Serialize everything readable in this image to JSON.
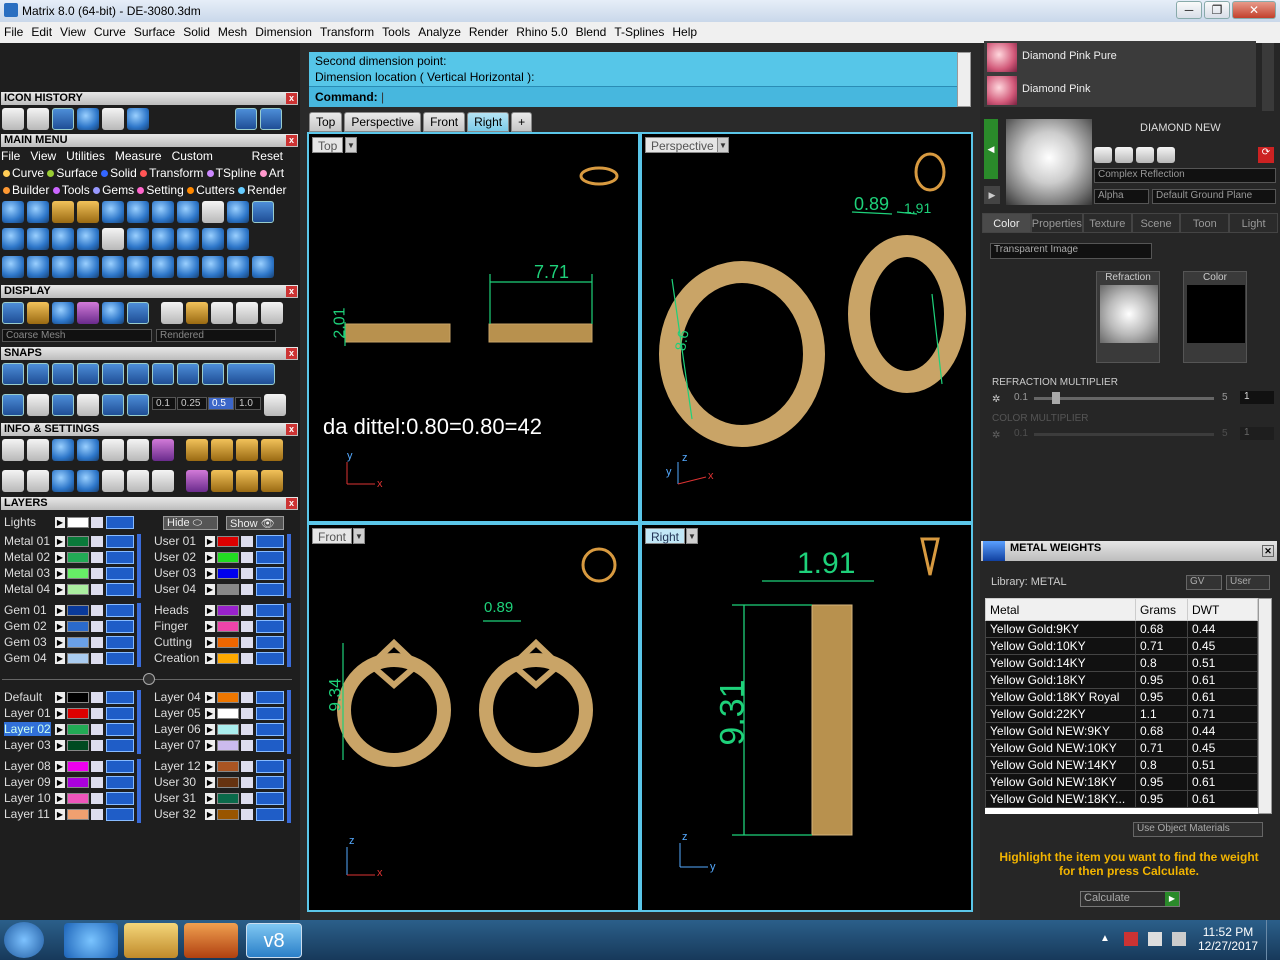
{
  "window": {
    "title": "Matrix 8.0 (64-bit) - DE-3080.3dm",
    "controls": [
      "─",
      "❐",
      "✕"
    ]
  },
  "menu": [
    "File",
    "Edit",
    "View",
    "Curve",
    "Surface",
    "Solid",
    "Mesh",
    "Dimension",
    "Transform",
    "Tools",
    "Analyze",
    "Render",
    "Rhino 5.0",
    "Blend",
    "T-Splines",
    "Help"
  ],
  "left": {
    "icon_history": "ICON HISTORY",
    "main_menu": "MAIN MENU",
    "main_menu_items": [
      "File",
      "View",
      "Utilities",
      "Measure",
      "Custom"
    ],
    "reset": "Reset",
    "builders_row1": [
      "Curve",
      "Surface",
      "Solid",
      "Transform",
      "TSpline",
      "Art"
    ],
    "builders_row2": [
      "Builder",
      "Tools",
      "Gems",
      "Setting",
      "Cutters",
      "Render"
    ],
    "display": "DISPLAY",
    "mesh_combo": "Coarse Mesh",
    "render_combo": "Rendered",
    "snaps": "SNAPS",
    "snap_values": [
      "0.1",
      "0.25",
      "0.5",
      "1.0"
    ],
    "info_settings": "INFO & SETTINGS",
    "layers": "LAYERS",
    "lights": "Lights",
    "hide": "Hide",
    "show": "Show",
    "layers_left": [
      {
        "name": "Metal 01",
        "color": "#0a7a3a"
      },
      {
        "name": "Metal 02",
        "color": "#22aa55"
      },
      {
        "name": "Metal 03",
        "color": "#66ee66"
      },
      {
        "name": "Metal 04",
        "color": "#aaeea0"
      },
      {
        "name": "Gem 01",
        "color": "#0a3a9a"
      },
      {
        "name": "Gem 02",
        "color": "#2a6acc"
      },
      {
        "name": "Gem 03",
        "color": "#6aa0e8"
      },
      {
        "name": "Gem 04",
        "color": "#aaccf0"
      },
      {
        "name": "Default",
        "color": "#000000"
      },
      {
        "name": "Layer 01",
        "color": "#dd0000"
      },
      {
        "name": "Layer 02",
        "color": "#22aa55"
      },
      {
        "name": "Layer 03",
        "color": "#004a20"
      },
      {
        "name": "Layer 08",
        "color": "#ee00ee"
      },
      {
        "name": "Layer 09",
        "color": "#aa00dd"
      },
      {
        "name": "Layer 10",
        "color": "#ee55bb"
      },
      {
        "name": "Layer 11",
        "color": "#f0a070"
      }
    ],
    "layers_right": [
      {
        "name": "User 01",
        "color": "#dd0000"
      },
      {
        "name": "User 02",
        "color": "#22dd22"
      },
      {
        "name": "User 03",
        "color": "#0000ee"
      },
      {
        "name": "User 04",
        "color": "#888888"
      },
      {
        "name": "Heads",
        "color": "#9922cc"
      },
      {
        "name": "Finger",
        "color": "#ee44aa"
      },
      {
        "name": "Cutting",
        "color": "#ee6600"
      },
      {
        "name": "Creation",
        "color": "#ffaa00"
      },
      {
        "name": "Layer 04",
        "color": "#ee7700"
      },
      {
        "name": "Layer 05",
        "color": "#ffffff"
      },
      {
        "name": "Layer 06",
        "color": "#aaeeee"
      },
      {
        "name": "Layer 07",
        "color": "#ccbbee"
      },
      {
        "name": "Layer 12",
        "color": "#aa5522"
      },
      {
        "name": "User 30",
        "color": "#663311"
      },
      {
        "name": "User 31",
        "color": "#0a6a4a"
      },
      {
        "name": "User 32",
        "color": "#995500"
      }
    ]
  },
  "command": {
    "line1": "Second dimension point:",
    "line2": "Dimension location ( Vertical  Horizontal ):",
    "prompt": "Command:"
  },
  "tabs": [
    "Top",
    "Perspective",
    "Front",
    "Right",
    "+"
  ],
  "viewports": {
    "top": {
      "label": "Top",
      "dim_w": "7.71",
      "dim_h": "2.01",
      "note": "da dittel:0.80=0.80=42",
      "ax1": "y",
      "ax2": "x"
    },
    "perspective": {
      "label": "Perspective",
      "dim_a": "0.89",
      "dim_b": "1.91",
      "dim_c": "8.6",
      "ax1": "z",
      "ax2": "x",
      "ax3": "y"
    },
    "front": {
      "label": "Front",
      "dim_h": "9.34",
      "dim_w": "0.89",
      "ax1": "z",
      "ax2": "x"
    },
    "right": {
      "label": "Right",
      "dim_w": "1.91",
      "dim_h": "9.31",
      "ax1": "z",
      "ax2": "y"
    }
  },
  "right": {
    "materials": [
      "Diamond Pink Pure",
      "Diamond Pink"
    ],
    "material_name": "DIAMOND NEW",
    "reflection": "Complex Reflection",
    "alpha": "Alpha",
    "ground": "Default Ground Plane",
    "tabs": [
      "Color",
      "Properties",
      "Texture",
      "Scene",
      "Toon",
      "Light"
    ],
    "transparent": "Transparent Image",
    "refraction": "Refraction",
    "color": "Color",
    "refraction_mult": "REFRACTION MULTIPLIER",
    "color_mult": "COLOR MULTIPLIER",
    "slider_min": "0.1",
    "slider_max": "5",
    "slider_val": "1",
    "mw_title": "METAL WEIGHTS",
    "library": "Library: METAL",
    "gv": "GV",
    "user": "User",
    "columns": [
      "Metal",
      "Grams",
      "DWT"
    ],
    "rows": [
      [
        "Yellow Gold:9KY",
        "0.68",
        "0.44"
      ],
      [
        "Yellow Gold:10KY",
        "0.71",
        "0.45"
      ],
      [
        "Yellow Gold:14KY",
        "0.8",
        "0.51"
      ],
      [
        "Yellow Gold:18KY",
        "0.95",
        "0.61"
      ],
      [
        "Yellow Gold:18KY Royal",
        "0.95",
        "0.61"
      ],
      [
        "Yellow Gold:22KY",
        "1.1",
        "0.71"
      ],
      [
        "Yellow Gold NEW:9KY",
        "0.68",
        "0.44"
      ],
      [
        "Yellow Gold NEW:10KY",
        "0.71",
        "0.45"
      ],
      [
        "Yellow Gold NEW:14KY",
        "0.8",
        "0.51"
      ],
      [
        "Yellow Gold NEW:18KY",
        "0.95",
        "0.61"
      ],
      [
        "Yellow Gold NEW:18KY...",
        "0.95",
        "0.61"
      ]
    ],
    "use_obj": "Use Object Materials",
    "hint": "Highlight the item you want to find the weight for then press Calculate.",
    "calculate": "Calculate"
  },
  "taskbar": {
    "time": "11:52 PM",
    "date": "12/27/2017",
    "app": "v8"
  }
}
